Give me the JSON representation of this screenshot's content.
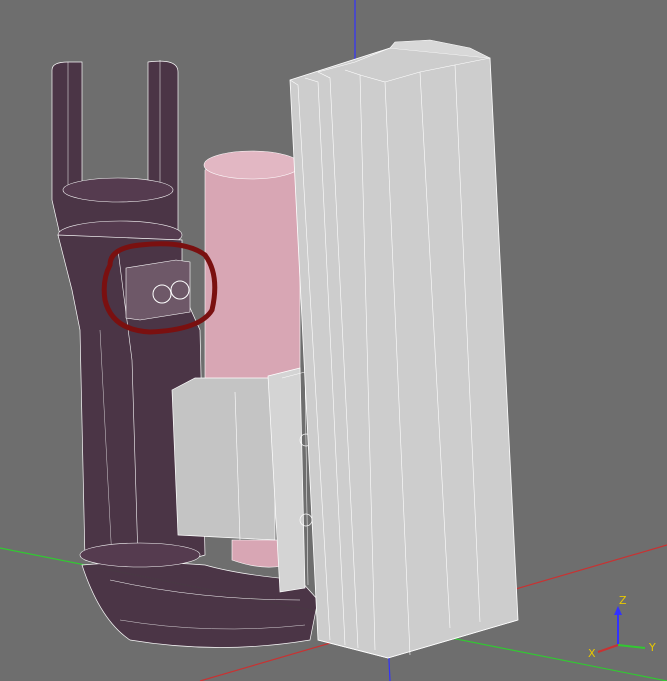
{
  "viewport": {
    "background": "#6e6e6e",
    "axes": {
      "x_axis_color": "#c83232",
      "y_axis_color": "#32c832",
      "z_axis_color": "#3232ff"
    },
    "highlight_color": "#7a1010"
  },
  "model": {
    "housing_color": "#4a3345",
    "cylinder_color": "#d8a6b4",
    "bracket_color": "#c8c8c8",
    "extrusion_color": "#cfcfcf",
    "edge_color": "#ffffff"
  },
  "axis_gizmo": {
    "z_label": "Z",
    "y_label": "Y",
    "x_label": "X",
    "z_color": "#e8c800",
    "y_color": "#e8c800",
    "x_color": "#e8c800"
  }
}
